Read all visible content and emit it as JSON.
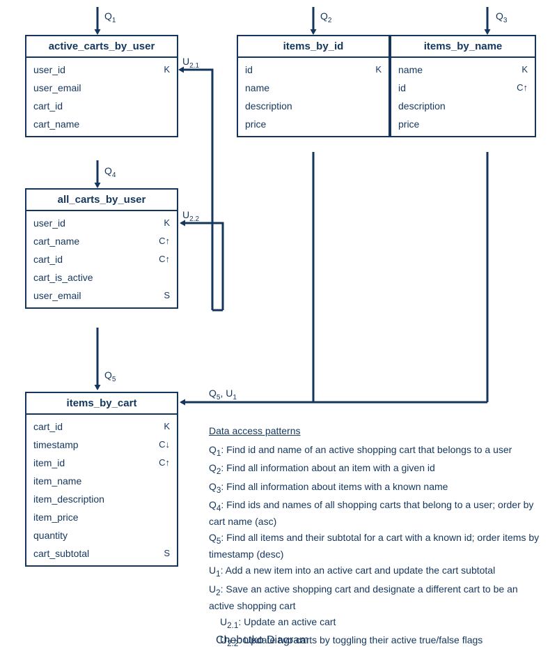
{
  "caption": "Chebotko Diagram",
  "labels": {
    "q1": "Q<sub>1</sub>",
    "q2": "Q<sub>2</sub>",
    "q3": "Q<sub>3</sub>",
    "q4": "Q<sub>4</sub>",
    "q5": "Q<sub>5</sub>",
    "u21": "U<sub>2.1</sub>",
    "u22": "U<sub>2.2</sub>",
    "q5u1": "Q<sub>5</sub>, U<sub>1</sub>"
  },
  "tables": {
    "active_carts_by_user": {
      "title": "active_carts_by_user",
      "rows": [
        {
          "name": "user_id",
          "key": "K"
        },
        {
          "name": "user_email",
          "key": ""
        },
        {
          "name": "cart_id",
          "key": ""
        },
        {
          "name": "cart_name",
          "key": ""
        }
      ]
    },
    "items_by_id": {
      "title": "items_by_id",
      "rows": [
        {
          "name": "id",
          "key": "K"
        },
        {
          "name": "name",
          "key": ""
        },
        {
          "name": "description",
          "key": ""
        },
        {
          "name": "price",
          "key": ""
        }
      ]
    },
    "items_by_name": {
      "title": "items_by_name",
      "rows": [
        {
          "name": "name",
          "key": "K"
        },
        {
          "name": "id",
          "key": "C↑"
        },
        {
          "name": "description",
          "key": ""
        },
        {
          "name": "price",
          "key": ""
        }
      ]
    },
    "all_carts_by_user": {
      "title": "all_carts_by_user",
      "rows": [
        {
          "name": "user_id",
          "key": "K"
        },
        {
          "name": "cart_name",
          "key": "C↑"
        },
        {
          "name": "cart_id",
          "key": "C↑"
        },
        {
          "name": "cart_is_active",
          "key": ""
        },
        {
          "name": "user_email",
          "key": "S"
        }
      ]
    },
    "items_by_cart": {
      "title": "items_by_cart",
      "rows": [
        {
          "name": "cart_id",
          "key": "K"
        },
        {
          "name": "timestamp",
          "key": "C↓"
        },
        {
          "name": "item_id",
          "key": "C↑"
        },
        {
          "name": "item_name",
          "key": ""
        },
        {
          "name": "item_description",
          "key": ""
        },
        {
          "name": "item_price",
          "key": ""
        },
        {
          "name": "quantity",
          "key": ""
        },
        {
          "name": "cart_subtotal",
          "key": "S"
        }
      ]
    }
  },
  "patterns": {
    "title": "Data access patterns",
    "items": [
      {
        "label": "Q<sub>1</sub>:",
        "text": "Find id and name of an active shopping cart that belongs to a user"
      },
      {
        "label": "Q<sub>2</sub>:",
        "text": "Find all information about an item with a given id"
      },
      {
        "label": "Q<sub>3</sub>:",
        "text": "Find all information about items with a known name"
      },
      {
        "label": "Q<sub>4</sub>:",
        "text": "Find ids and names of all shopping carts that belong to a user; order by cart name (asc)"
      },
      {
        "label": "Q<sub>5</sub>:",
        "text": "Find all items and their subtotal for a cart with a known id; order items by timestamp (desc)"
      },
      {
        "label": "U<sub>1</sub>:",
        "text": "Add a new item into an active cart and update the cart subtotal"
      },
      {
        "label": "U<sub>2</sub>:",
        "text": "Save an active shopping cart and designate a different cart to be an active shopping cart"
      },
      {
        "label": "",
        "text": "U<sub>2.1</sub>: Update an active cart",
        "indent": true
      },
      {
        "label": "",
        "text": "U<sub>2.2</sub>: Update two carts by toggling their active true/false flags",
        "indent": true
      }
    ]
  }
}
